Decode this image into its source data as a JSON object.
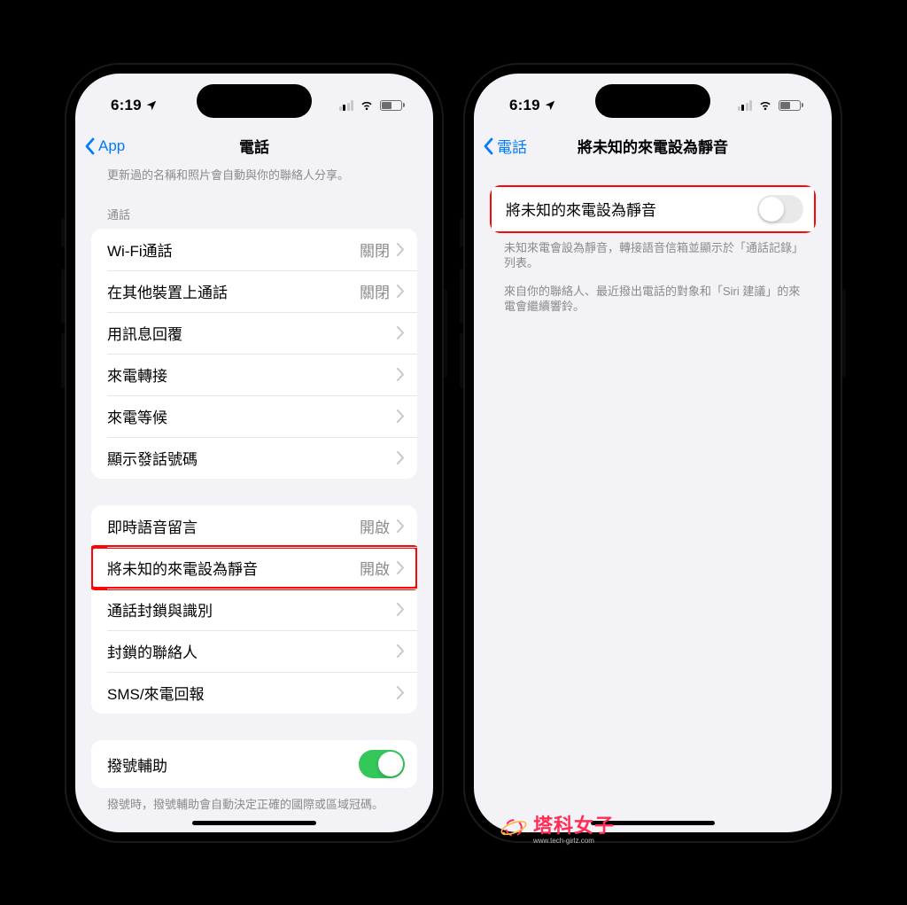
{
  "status": {
    "time": "6:19",
    "location_glyph": "➤"
  },
  "phone1": {
    "nav": {
      "back": "App",
      "title": "電話"
    },
    "topDesc": "更新過的名稱和照片會自動與你的聯絡人分享。",
    "sectionCall": "通話",
    "rows1": [
      {
        "label": "Wi-Fi通話",
        "value": "關閉"
      },
      {
        "label": "在其他裝置上通話",
        "value": "關閉"
      },
      {
        "label": "用訊息回覆",
        "value": ""
      },
      {
        "label": "來電轉接",
        "value": ""
      },
      {
        "label": "來電等候",
        "value": ""
      },
      {
        "label": "顯示發話號碼",
        "value": ""
      }
    ],
    "rows2": [
      {
        "label": "即時語音留言",
        "value": "開啟"
      },
      {
        "label": "將未知的來電設為靜音",
        "value": "開啟",
        "highlight": true
      },
      {
        "label": "通話封鎖與識別",
        "value": ""
      },
      {
        "label": "封鎖的聯絡人",
        "value": ""
      },
      {
        "label": "SMS/來電回報",
        "value": ""
      }
    ],
    "dialAssist": {
      "label": "撥號輔助",
      "on": true
    },
    "dialDesc": "撥號時，撥號輔助會自動決定正確的國際或區域冠碼。"
  },
  "phone2": {
    "nav": {
      "back": "電話",
      "title": "將未知的來電設為靜音"
    },
    "toggleRow": {
      "label": "將未知的來電設為靜音",
      "on": false,
      "highlight": true
    },
    "desc1": "未知來電會設為靜音，轉接語音信箱並顯示於「通話記錄」列表。",
    "desc2": "來自你的聯絡人、最近撥出電話的對象和「Siri 建議」的來電會繼續響鈴。"
  },
  "watermark": {
    "text": "塔科女子",
    "sub": "www.tech-girlz.com"
  }
}
